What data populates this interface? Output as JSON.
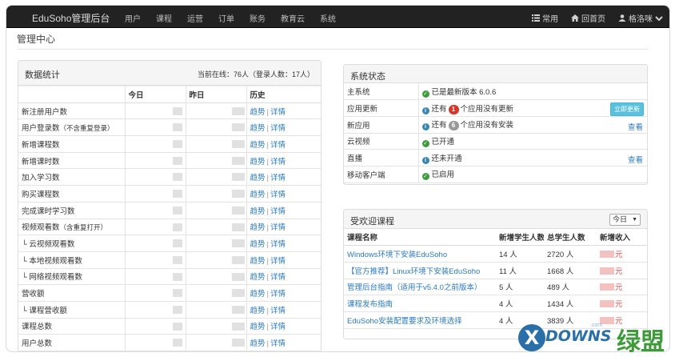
{
  "nav": {
    "brand": "EduSoho管理后台",
    "items": [
      "用户",
      "课程",
      "运营",
      "订单",
      "账务",
      "教育云",
      "系统"
    ],
    "right": [
      {
        "label": "常用",
        "icon": "list-icon"
      },
      {
        "label": "回首页",
        "icon": "home-icon"
      },
      {
        "label": "格洛咪",
        "icon": "user-icon"
      }
    ]
  },
  "page": {
    "title": "管理中心"
  },
  "stats": {
    "title": "数据统计",
    "online": "当前在线：76人（登录人数：17人）",
    "headers": [
      "今日",
      "昨日",
      "历史"
    ],
    "trend_label": "趋势",
    "detail_label": "详情",
    "separator": "|",
    "rows": [
      {
        "name": "新注册用户数",
        "sub": ""
      },
      {
        "name": "用户登录数",
        "sub": "（不含重复登录）"
      },
      {
        "name": "新增课程数",
        "sub": ""
      },
      {
        "name": "新增课时数",
        "sub": ""
      },
      {
        "name": "加入学习数",
        "sub": ""
      },
      {
        "name": "购买课程数",
        "sub": ""
      },
      {
        "name": "完成课时学习数",
        "sub": ""
      },
      {
        "name": "视频观看数",
        "sub": "（含重复打开）"
      },
      {
        "name": "└ 云视频观看数",
        "sub": ""
      },
      {
        "name": "└ 本地视频观看数",
        "sub": ""
      },
      {
        "name": "└ 网络视频观看数",
        "sub": ""
      },
      {
        "name": "营收额",
        "sub": ""
      },
      {
        "name": "└ 课程营收额",
        "sub": ""
      },
      {
        "name": "课程总数",
        "sub": ""
      },
      {
        "name": "用户总数",
        "sub": ""
      }
    ]
  },
  "system": {
    "title": "系统状态",
    "rows": [
      {
        "key": "主系统",
        "icon": "check-icon",
        "text_before": "已是最新版本 6.0.6",
        "badge": "",
        "text_after": "",
        "action": ""
      },
      {
        "key": "应用更新",
        "icon": "info-icon",
        "text_before": "还有",
        "badge": "1",
        "text_after": "个应用没有更新",
        "action": "立即更新"
      },
      {
        "key": "新应用",
        "icon": "info-icon",
        "text_before": "还有",
        "badge": "6",
        "text_after": "个应用没有安装",
        "action": "查看"
      },
      {
        "key": "云视频",
        "icon": "check-icon",
        "text_before": "已开通",
        "badge": "",
        "text_after": "",
        "action": ""
      },
      {
        "key": "直播",
        "icon": "info-icon",
        "text_before": "还未开通",
        "badge": "",
        "text_after": "",
        "action": "查看"
      },
      {
        "key": "移动客户端",
        "icon": "check-icon",
        "text_before": "已启用",
        "badge": "",
        "text_after": "",
        "action": ""
      }
    ]
  },
  "popular": {
    "title": "受欢迎课程",
    "range": "今日",
    "headers": [
      "课程名称",
      "新增学生人数",
      "总学生人数",
      "新增收入"
    ],
    "yuan": "元",
    "rows": [
      {
        "name": "Windows环境下安装EduSoho",
        "new": "14 人",
        "total": "2720 人"
      },
      {
        "name": "【官方推荐】Linux环境下安装EduSoho",
        "new": "11 人",
        "total": "1668 人"
      },
      {
        "name": "管理后台指南（适用于v5.4.0之前版本）",
        "new": "5 人",
        "total": "489 人"
      },
      {
        "name": "课程发布指南",
        "new": "4 人",
        "total": "1434 人"
      },
      {
        "name": "EduSoho安装配置要求及环境选择",
        "new": "4 人",
        "total": "3839 人"
      }
    ]
  },
  "watermark": {
    "letter": "X",
    "word": "DOWNS",
    "com": ".com",
    "cn": "绿盟"
  }
}
